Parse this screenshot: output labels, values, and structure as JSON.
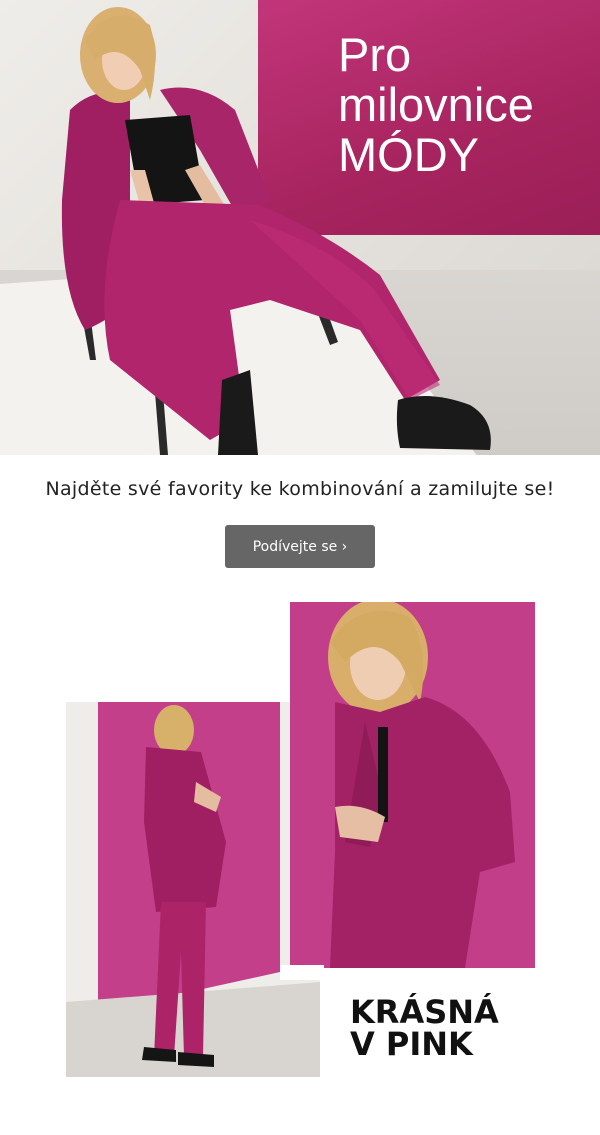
{
  "hero": {
    "title_line1": "Pro",
    "title_line2": "milovnice",
    "title_line3": "MÓDY",
    "accent_color": "#a7245f",
    "image": "woman-in-magenta-suit-sitting-on-chair"
  },
  "tagline": "Najděte své favority ke kombinování a zamilujte se!",
  "cta": {
    "label": "Podívejte se ›",
    "color": "#666666"
  },
  "lookbook": {
    "left_image": "woman-in-magenta-suit-standing-profile",
    "right_image": "woman-buttoning-magenta-blazer",
    "headline_line1": "KRÁSNÁ",
    "headline_line2": "V PINK"
  },
  "colors": {
    "magenta": "#b0256b",
    "pink_wall": "#c43f8a",
    "text": "#111111"
  }
}
